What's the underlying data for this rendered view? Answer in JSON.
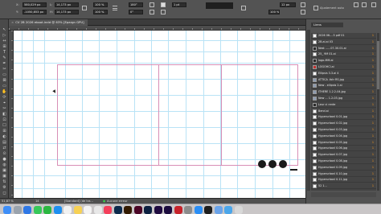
{
  "control_bar": {
    "x_value": "580,029 px",
    "y_value": "-1050,853 px",
    "w_value": "14,173 px",
    "h_value": "14,173 px",
    "scale_x": "100 %",
    "scale_y": "100 %",
    "rotation": "180°",
    "shear": "0°",
    "stroke_weight": "1 pt",
    "corner_size": "12 px",
    "opacity": "100 %",
    "fit_option": "Ajustement auto"
  },
  "document_tab": {
    "title": "CV 2B 2026 eboot.indd @ 63% [Epargn GPU]",
    "close": "×"
  },
  "tools": [
    "↖",
    "▷",
    "↔",
    "⊞",
    "T",
    "✎",
    "✒",
    "✂",
    "▭",
    "⊠",
    "▭",
    "✋",
    "⟳",
    "⌖",
    "✂",
    "◧",
    "⊡",
    "☐",
    "⊞",
    "◐",
    "▤",
    "⇄",
    "⊙",
    "●",
    "◍",
    "▣",
    "▣",
    "⇅",
    "⚙",
    "◻"
  ],
  "links_panel": {
    "tab_label": "Liens",
    "items": [
      {
        "name": "2026 06-...5 pdf 01",
        "page": "1",
        "thumb": "doc"
      },
      {
        "name": "2B.ai.ai 03",
        "page": "1",
        "thumb": "doc"
      },
      {
        "name": "Nest ......07-30.01.ai",
        "page": "1",
        "thumb": "dark"
      },
      {
        "name": "25_ 9M 01.ai",
        "page": "1",
        "thumb": "doc"
      },
      {
        "name": "logo-MM.ai",
        "page": "1",
        "thumb": "dark"
      },
      {
        "name": "LOGOHCl.ai",
        "page": "1",
        "thumb": "red"
      },
      {
        "name": "Ellipsis 3.3.ai 4",
        "page": "1",
        "thumb": "doc"
      },
      {
        "name": "ATTICA .fotr RS.jpg",
        "page": "1",
        "thumb": "img"
      },
      {
        "name": "New - ellipsis 2.ai",
        "page": "1",
        "thumb": "img"
      },
      {
        "name": "ITHERE 1.2.2-04.jpg",
        "page": "1",
        "thumb": "img"
      },
      {
        "name": "New ... 1.2-03.jpg",
        "page": "1",
        "thumb": "img"
      },
      {
        "name": "Leur ci rente",
        "page": "1",
        "thumb": "dark"
      },
      {
        "name": "Bend.ai",
        "page": "1",
        "thumb": "doc"
      },
      {
        "name": "Hyperurbanl 0.01.jpg",
        "page": "1",
        "thumb": "doc"
      },
      {
        "name": "Hyperurbanl 0.02.jpg",
        "page": "1",
        "thumb": "doc"
      },
      {
        "name": "Hyperurbanl 0.03.jpg",
        "page": "1",
        "thumb": "doc"
      },
      {
        "name": "Hyperurbanl 0.04.jpg",
        "page": "1",
        "thumb": "doc"
      },
      {
        "name": "Hyperurbanl 0.05.jpg",
        "page": "1",
        "thumb": "doc"
      },
      {
        "name": "Hyperurbanl 0.06.jpg",
        "page": "1",
        "thumb": "doc"
      },
      {
        "name": "Hyperurbanl 0.07.jpg",
        "page": "1",
        "thumb": "doc"
      },
      {
        "name": "Hyperurbanl 0.08.jpg",
        "page": "1",
        "thumb": "doc"
      },
      {
        "name": "Hyperurbanl 0.09.jpg",
        "page": "1",
        "thumb": "doc"
      },
      {
        "name": "Hyperurbanl 0.10.jpg",
        "page": "1",
        "thumb": "doc"
      },
      {
        "name": "Hyperurbanl 0.11.jpg",
        "page": "1",
        "thumb": "doc"
      },
      {
        "name": "52 1...",
        "page": "1",
        "thumb": "doc"
      }
    ]
  },
  "status_bar": {
    "zoom": "51,87 %",
    "page": "14",
    "preflight_profile": "[Standard] (de tra...",
    "preflight_status": "Aucune erreur"
  },
  "dock": {
    "apps": [
      {
        "name": "finder",
        "color": "#3e8ef7"
      },
      {
        "name": "launchpad",
        "color": "#9aa3ad"
      },
      {
        "name": "mail",
        "color": "#2f78e6"
      },
      {
        "name": "messages",
        "color": "#37c85a"
      },
      {
        "name": "whatsapp",
        "color": "#2bb741"
      },
      {
        "name": "safari",
        "color": "#1e8ff0"
      },
      {
        "name": "calendar",
        "color": "#f2f2f2"
      },
      {
        "name": "notes",
        "color": "#f7d154"
      },
      {
        "name": "reminders",
        "color": "#f4f4f4"
      },
      {
        "name": "photos",
        "color": "#e8e8e8"
      },
      {
        "name": "music",
        "color": "#f43f5b"
      },
      {
        "name": "photoshop",
        "color": "#0c2a4c"
      },
      {
        "name": "illustrator",
        "color": "#331a00"
      },
      {
        "name": "indesign",
        "color": "#4b0626"
      },
      {
        "name": "lightroom",
        "color": "#0c2040"
      },
      {
        "name": "premiere",
        "color": "#1f0b40"
      },
      {
        "name": "after-effects",
        "color": "#1b0b3e"
      },
      {
        "name": "acrobat",
        "color": "#c7222a"
      },
      {
        "name": "system-preferences",
        "color": "#8c8c8c"
      },
      {
        "name": "app-store",
        "color": "#2a8ef5"
      },
      {
        "name": "terminal",
        "color": "#1e1e1e"
      },
      {
        "name": "preview",
        "color": "#6aa3e8"
      },
      {
        "name": "folder",
        "color": "#4ba6ea"
      },
      {
        "name": "trash",
        "color": "#d8d8d8"
      }
    ]
  },
  "colors": {
    "guides": "#b9e3f6",
    "frame": "#d88fb6",
    "page_number": "#ff9c1a"
  }
}
